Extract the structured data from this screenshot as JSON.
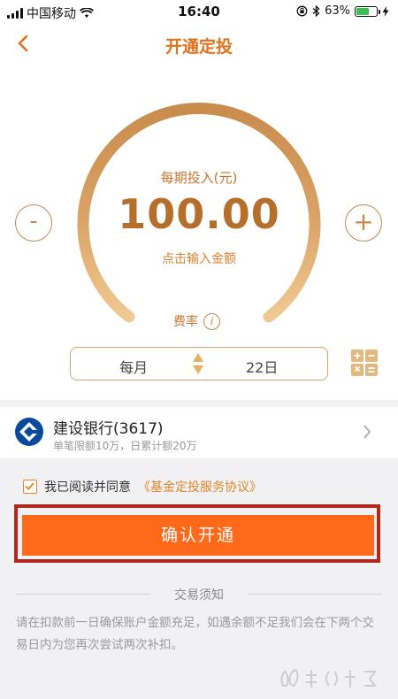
{
  "status_bar": {
    "carrier": "中国移动",
    "time": "16:40",
    "battery": "63%",
    "battery_level": 0.63
  },
  "nav": {
    "title": "开通定投"
  },
  "dial": {
    "label": "每期投入(元)",
    "amount": "100.00",
    "hint": "点击输入金额",
    "minus": "-",
    "plus": "+",
    "fee_label": "费率",
    "fee_icon_text": "i"
  },
  "schedule": {
    "frequency": "每月",
    "day": "22日"
  },
  "bank": {
    "name": "建设银行(3617)",
    "limits": "单笔限额10万，日累计额20万"
  },
  "agreement": {
    "text": "我已阅读并同意",
    "link": "《基金定投服务协议》",
    "checked": true
  },
  "confirm": {
    "label": "确认开通"
  },
  "notice": {
    "title": "交易须知",
    "body": "请在扣款前一日确保账户金额充足，如遇余额不足我们会在下两个交易日内为您再次尝试两次补扣。"
  },
  "colors": {
    "accent": "#e0721d",
    "button": "#ff6a1a",
    "highlight_frame": "#b0271d",
    "dial_gold": "#d9a160"
  }
}
